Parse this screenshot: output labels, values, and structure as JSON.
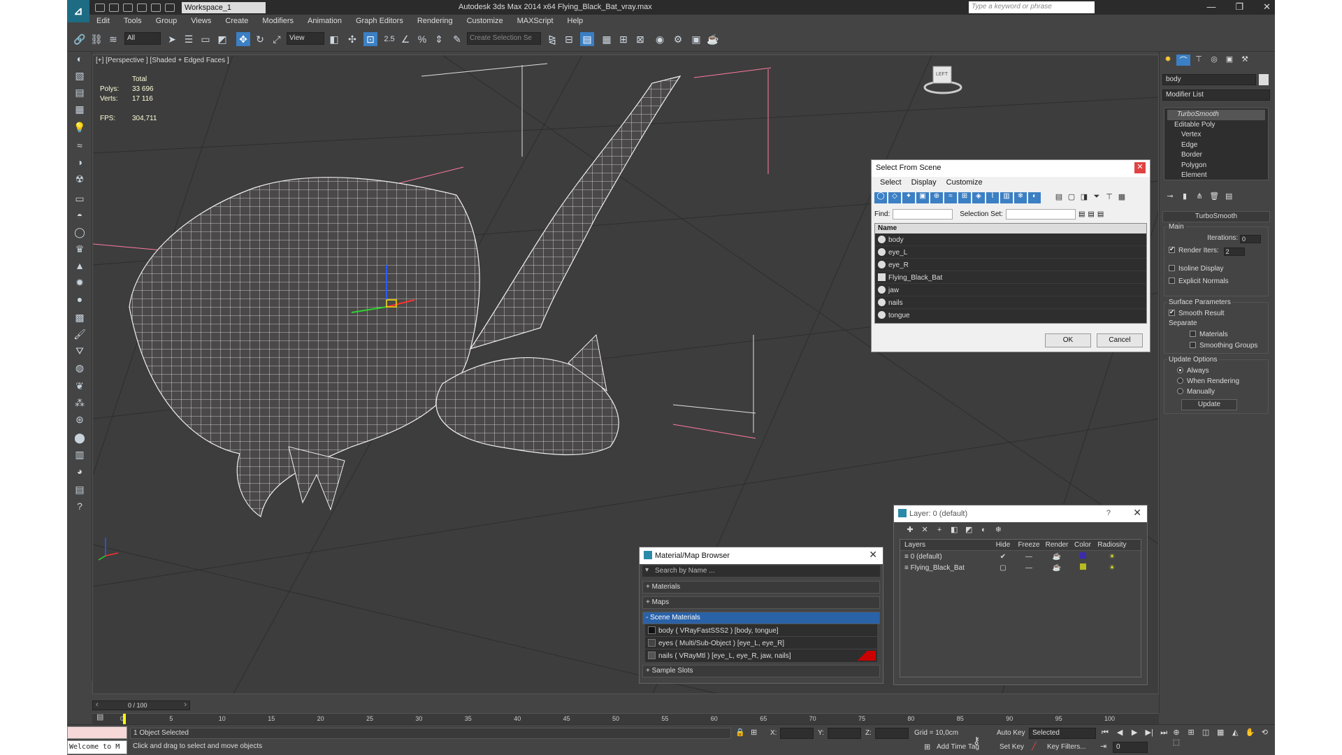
{
  "titlebar": {
    "workspace": "Workspace_1",
    "app_title": "Autodesk 3ds Max  2014 x64",
    "file_title": "Flying_Black_Bat_vray.max",
    "search_placeholder": "Type a keyword or phrase"
  },
  "menu": [
    "Edit",
    "Tools",
    "Group",
    "Views",
    "Create",
    "Modifiers",
    "Animation",
    "Graph Editors",
    "Rendering",
    "Customize",
    "MAXScript",
    "Help"
  ],
  "toolbar": {
    "selection_filter": "All",
    "ref_coord": "View",
    "snaps_label": "2.5",
    "selection_set_placeholder": "Create Selection Se"
  },
  "viewport": {
    "label": "[+] [Perspective ] [Shaded + Edged Faces ]",
    "stats": {
      "total_label": "Total",
      "polys_label": "Polys:",
      "polys": "33 696",
      "verts_label": "Verts:",
      "verts": "17 116",
      "fps_label": "FPS:",
      "fps": "304,711"
    },
    "viewcube_label": "LEFT"
  },
  "select_from_scene": {
    "title": "Select From Scene",
    "menu": [
      "Select",
      "Display",
      "Customize"
    ],
    "find_label": "Find:",
    "selection_set_label": "Selection Set:",
    "column_name": "Name",
    "items": [
      "body",
      "eye_L",
      "eye_R",
      "Flying_Black_Bat",
      "jaw",
      "nails",
      "tongue"
    ],
    "ok": "OK",
    "cancel": "Cancel"
  },
  "material_browser": {
    "title": "Material/Map Browser",
    "search_placeholder": "Search by Name ...",
    "groups": [
      "+ Materials",
      "+ Maps",
      "- Scene Materials",
      "+ Sample Slots"
    ],
    "scene_materials": [
      "body  ( VRayFastSSS2 ) [body, tongue]",
      "eyes  ( Multi/Sub-Object ) [eye_L, eye_R]",
      "nails  ( VRayMtl ) [eye_L, eye_R, jaw, nails]"
    ]
  },
  "layer_dialog": {
    "title": "Layer: 0 (default)",
    "help": "?",
    "columns": [
      "Layers",
      "Hide",
      "Freeze",
      "Render",
      "Color",
      "Radiosity"
    ],
    "rows": [
      {
        "name": "0 (default)",
        "color": "#3a2bb0"
      },
      {
        "name": "Flying_Black_Bat",
        "color": "#b8b820"
      }
    ]
  },
  "command_panel": {
    "object_name": "body",
    "modifier_list": "Modifier List",
    "stack": [
      "TurboSmooth",
      "Editable Poly",
      "Vertex",
      "Edge",
      "Border",
      "Polygon",
      "Element"
    ],
    "rollout_title": "TurboSmooth",
    "main_label": "Main",
    "iterations_label": "Iterations:",
    "iterations": "0",
    "render_iters_label": "Render Iters:",
    "render_iters": "2",
    "isoline": "Isoline Display",
    "explicit_normals": "Explicit Normals",
    "surface_params": "Surface Parameters",
    "smooth_result": "Smooth Result",
    "separate": "Separate",
    "materials": "Materials",
    "smoothing_groups": "Smoothing Groups",
    "update_options": "Update Options",
    "always": "Always",
    "when_rendering": "When Rendering",
    "manually": "Manually",
    "update_button": "Update"
  },
  "timeline": {
    "frame_counter": "0 / 100",
    "ticks": [
      "0",
      "5",
      "10",
      "15",
      "20",
      "25",
      "30",
      "35",
      "40",
      "45",
      "50",
      "55",
      "60",
      "65",
      "70",
      "75",
      "80",
      "85",
      "90",
      "95",
      "100"
    ]
  },
  "status": {
    "maxscript": "Welcome to M",
    "selected": "1 Object Selected",
    "prompt": "Click and drag to select and move objects",
    "x_label": "X:",
    "y_label": "Y:",
    "z_label": "Z:",
    "grid": "Grid = 10,0cm",
    "add_time_tag": "Add Time Tag",
    "auto_key": "Auto Key",
    "set_key": "Set Key",
    "key_mode": "Selected",
    "key_filters": "Key Filters...",
    "current_frame": "0"
  }
}
